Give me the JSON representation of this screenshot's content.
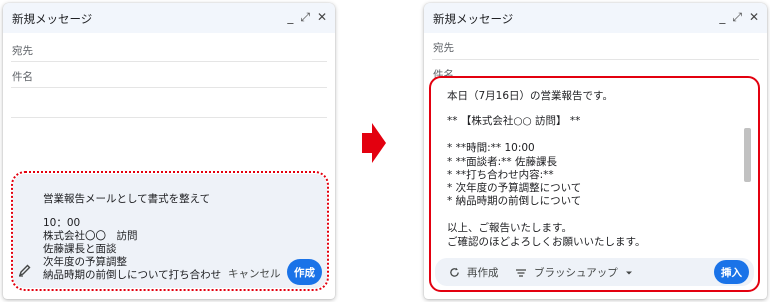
{
  "left": {
    "title": "新規メッセージ",
    "controls": {
      "minimize": "_",
      "expand": "⤢",
      "close": "✕"
    },
    "to_label": "宛先",
    "subject_label": "件名",
    "prompt_lines": [
      "営業報告メールとして書式を整えて",
      "10：00",
      "株式会社〇〇　訪問",
      "佐藤課長と面談",
      "次年度の予算調整",
      "納品時期の前倒しについて打ち合わせ"
    ],
    "cancel_label": "キャンセル",
    "create_label": "作成"
  },
  "right": {
    "title": "新規メッセージ",
    "controls": {
      "minimize": "_",
      "expand": "⤢",
      "close": "✕"
    },
    "to_label": "宛先",
    "subject_label": "件名",
    "result_lines": [
      "本日（7月16日）の営業報告です。",
      "** 【株式会社○○ 訪問】 **",
      "* **時間:** 10:00",
      "* **面談者:** 佐藤課長",
      "* **打ち合わせ内容:**",
      "* 次年度の予算調整について",
      "* 納品時期の前倒しについて",
      "以上、ご報告いたします。",
      "ご確認のほどよろしくお願いいたします。"
    ],
    "recreate_label": "再作成",
    "brushup_label": "ブラッシュアップ",
    "insert_label": "挿入"
  },
  "colors": {
    "accent": "#1a73e8",
    "highlight": "#e3000f",
    "panel": "#eef2f8"
  },
  "icons": [
    "pen-icon",
    "refresh-icon",
    "filter-lines-icon",
    "dropdown-caret-icon",
    "arrow-right-icon"
  ]
}
